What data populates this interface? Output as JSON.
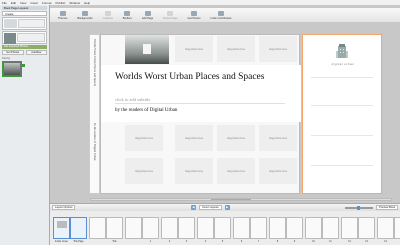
{
  "menubar": [
    "File",
    "Edit",
    "View",
    "Insert",
    "Format",
    "Publish",
    "Window",
    "Help"
  ],
  "toolbar": {
    "buttons": [
      {
        "label": "Themes"
      },
      {
        "label": "Backgrounds"
      },
      {
        "label": "Captions"
      },
      {
        "label": "Borders"
      },
      {
        "label": "Add Page"
      },
      {
        "label": "Delete Page"
      },
      {
        "label": "Get Photos"
      },
      {
        "label": "Invite Contributors"
      }
    ]
  },
  "left_panel": {
    "title": "Book Page Layouts",
    "create_label": "Create",
    "bar_label": "Get Imported Photos",
    "btn_get_photos": "Get Photos",
    "btn_autoflow": "Autoflow",
    "section_label": "Sort by"
  },
  "book": {
    "title": "Worlds Worst Urban Places and Spaces",
    "subtitle_placeholder": "click to add subtitle",
    "byline": "by the readers of Digital Urban",
    "spine_title": "Worlds Worst Urban Places and Spaces",
    "spine_byline": "by the readers of Digital Urban",
    "placeholder_text": "drag photos here",
    "logo_text": "digital urban"
  },
  "bottom": {
    "layouts_label": "Layout Options",
    "cover_label": "Cover Layouts",
    "preview_label": "Preview Book"
  },
  "filmstrip": {
    "spreads": [
      {
        "left": "Inside Cover",
        "right": "Title Page",
        "selected": true
      },
      {
        "left": "",
        "right": "Title"
      },
      {
        "left": "",
        "right": "1"
      },
      {
        "left": "2",
        "right": "3"
      },
      {
        "left": "4",
        "right": "5"
      },
      {
        "left": "6",
        "right": "7"
      },
      {
        "left": "8",
        "right": "9"
      },
      {
        "left": "10",
        "right": "11"
      },
      {
        "left": "12",
        "right": "13"
      },
      {
        "left": "14",
        "right": "15"
      }
    ]
  },
  "colors": {
    "selection_border": "#f5a66a",
    "accent_green": "#8fae6b",
    "accent_blue": "#5b8fd3"
  }
}
